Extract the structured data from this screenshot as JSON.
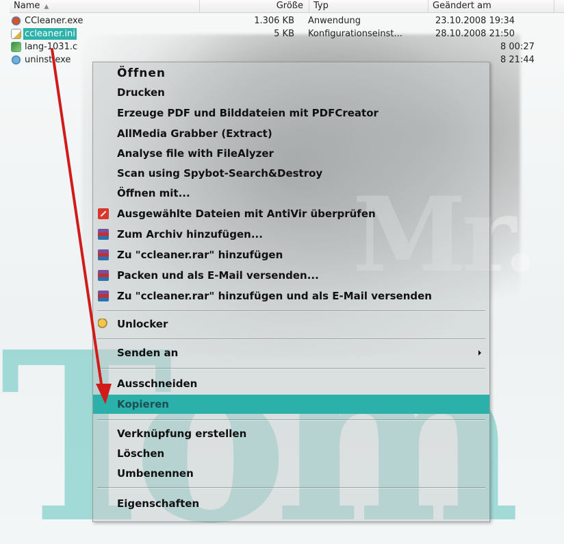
{
  "columns": {
    "name": "Name",
    "size": "Größe",
    "type": "Typ",
    "modified": "Geändert am"
  },
  "files": [
    {
      "name": "CCleaner.exe",
      "size": "1.306 KB",
      "type": "Anwendung",
      "modified": "23.10.2008 19:34",
      "icon": "ccleaner-exe-icon"
    },
    {
      "name": "ccleaner.ini",
      "size": "5 KB",
      "type": "Konfigurationseinst...",
      "modified": "28.10.2008 21:50",
      "icon": "ini-file-icon",
      "selected": true
    },
    {
      "name": "lang-1031.c",
      "size": "",
      "type": "",
      "modified": "8 00:27",
      "icon": "language-file-icon"
    },
    {
      "name": "uninst.exe",
      "size": "",
      "type": "",
      "modified": "8 21:44",
      "icon": "uninstaller-icon"
    }
  ],
  "context_menu": {
    "items": [
      {
        "label": "Öffnen",
        "default": true
      },
      {
        "label": "Drucken"
      },
      {
        "label": "Erzeuge PDF und Bilddateien mit PDFCreator"
      },
      {
        "label": "AllMedia Grabber (Extract)"
      },
      {
        "label": "Analyse file with FileAlyzer"
      },
      {
        "label": "Scan using Spybot-Search&Destroy"
      },
      {
        "label": "Öffnen mit..."
      },
      {
        "label": "Ausgewählte Dateien mit AntiVir überprüfen",
        "icon": "antivir-icon"
      },
      {
        "label": "Zum Archiv hinzufügen...",
        "icon": "winrar-icon"
      },
      {
        "label": "Zu \"ccleaner.rar\" hinzufügen",
        "icon": "winrar-icon"
      },
      {
        "label": "Packen und als E-Mail versenden...",
        "icon": "winrar-icon"
      },
      {
        "label": "Zu \"ccleaner.rar\" hinzufügen und als E-Mail versenden",
        "icon": "winrar-icon"
      },
      {
        "label": "Unlocker",
        "icon": "unlocker-icon"
      },
      {
        "label": "Senden an",
        "submenu": true
      },
      {
        "label": "Ausschneiden"
      },
      {
        "label": "Kopieren",
        "highlighted": true
      },
      {
        "label": "Verknüpfung erstellen"
      },
      {
        "label": "Löschen"
      },
      {
        "label": "Umbenennen"
      },
      {
        "label": "Eigenschaften"
      }
    ]
  },
  "watermark": {
    "top": "Mr.",
    "bottom": "Tom"
  },
  "colors": {
    "selection": "#2cb1aa",
    "arrow": "#d11a1a",
    "watermark": "#5fc3be"
  }
}
